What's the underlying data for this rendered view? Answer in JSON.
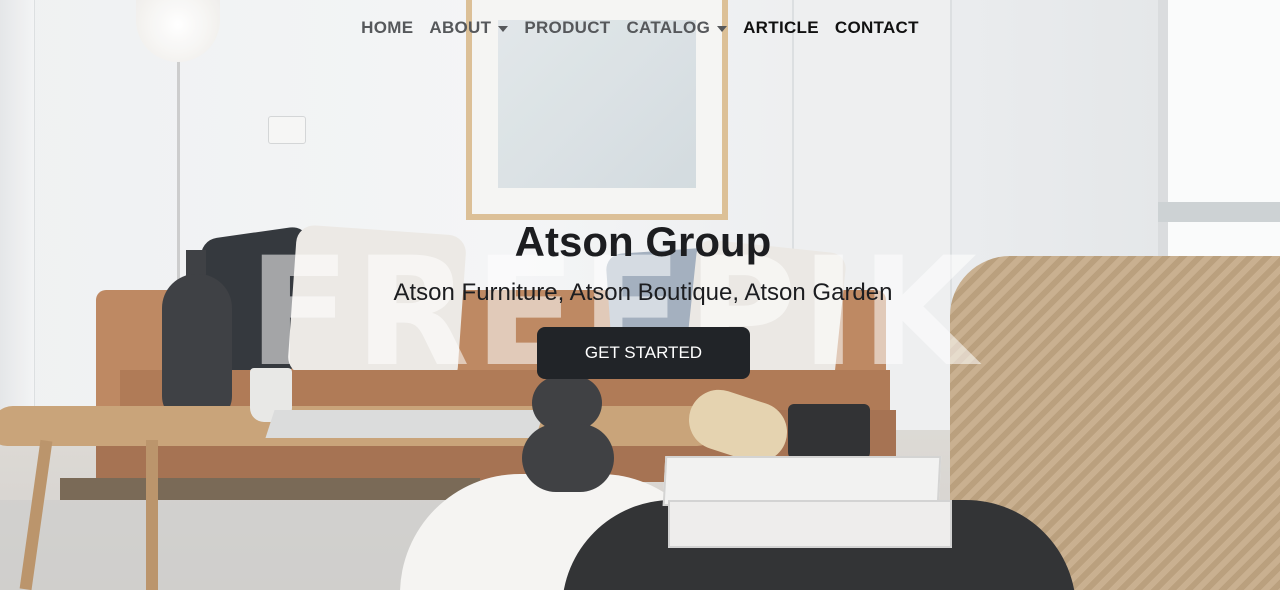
{
  "nav": {
    "items": [
      {
        "label": "HOME",
        "dropdown": false
      },
      {
        "label": "ABOUT",
        "dropdown": true
      },
      {
        "label": "PRODUCT",
        "dropdown": false
      },
      {
        "label": "CATALOG",
        "dropdown": true
      },
      {
        "label": "ARTICLE",
        "dropdown": false
      },
      {
        "label": "CONTACT",
        "dropdown": false
      }
    ]
  },
  "hero": {
    "title": "Atson Group",
    "subtitle": "Atson Furniture, Atson Boutique, Atson Garden",
    "cta_label": "GET STARTED"
  },
  "watermark": "FREEPIK",
  "colors": {
    "nav_text": "#56585b",
    "nav_text_active": "#111111",
    "cta_bg": "#212428",
    "cta_text": "#ffffff",
    "hero_text": "#1c1d20"
  },
  "icons": {
    "dropdown": "chevron-down-icon"
  }
}
